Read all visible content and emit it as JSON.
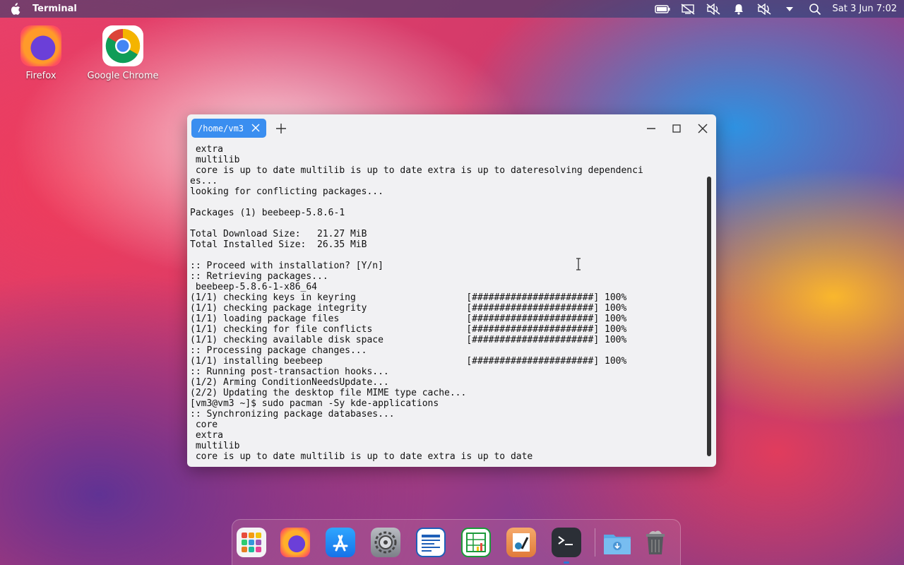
{
  "topbar": {
    "app_name": "Terminal",
    "clock": "Sat 3 Jun 7:02",
    "icons": [
      "apple-icon",
      "battery-icon",
      "network-off-icon",
      "volume-muted-icon",
      "notification-bell-icon",
      "audio-off-icon",
      "dropdown-arrow-icon",
      "search-icon"
    ]
  },
  "desktop": {
    "icons": [
      {
        "label": "Firefox",
        "icon": "firefox-icon"
      },
      {
        "label": "Google Chrome",
        "icon": "chrome-icon"
      }
    ]
  },
  "terminal": {
    "tab_title": "/home/vm3",
    "lines": [
      " extra",
      " multilib",
      " core is up to date multilib is up to date extra is up to dateresolving dependenci",
      "es...",
      "looking for conflicting packages...",
      "",
      "Packages (1) beebeep-5.8.6-1",
      "",
      "Total Download Size:   21.27 MiB",
      "Total Installed Size:  26.35 MiB",
      "",
      ":: Proceed with installation? [Y/n]",
      ":: Retrieving packages...",
      " beebeep-5.8.6-1-x86_64",
      "(1/1) checking keys in keyring                    [######################] 100%",
      "(1/1) checking package integrity                  [######################] 100%",
      "(1/1) loading package files                       [######################] 100%",
      "(1/1) checking for file conflicts                 [######################] 100%",
      "(1/1) checking available disk space               [######################] 100%",
      ":: Processing package changes...",
      "(1/1) installing beebeep                          [######################] 100%",
      ":: Running post-transaction hooks...",
      "(1/2) Arming ConditionNeedsUpdate...",
      "(2/2) Updating the desktop file MIME type cache...",
      "[vm3@vm3 ~]$ sudo pacman -Sy kde-applications",
      ":: Synchronizing package databases...",
      " core",
      " extra",
      " multilib",
      " core is up to date multilib is up to date extra is up to date"
    ]
  },
  "dock": {
    "items": [
      "launchpad-icon",
      "firefox-icon",
      "app-store-icon",
      "system-settings-icon",
      "writer-icon",
      "calc-icon",
      "draw-icon",
      "terminal-icon",
      "downloads-folder-icon",
      "trash-icon"
    ],
    "active": "terminal-icon"
  }
}
